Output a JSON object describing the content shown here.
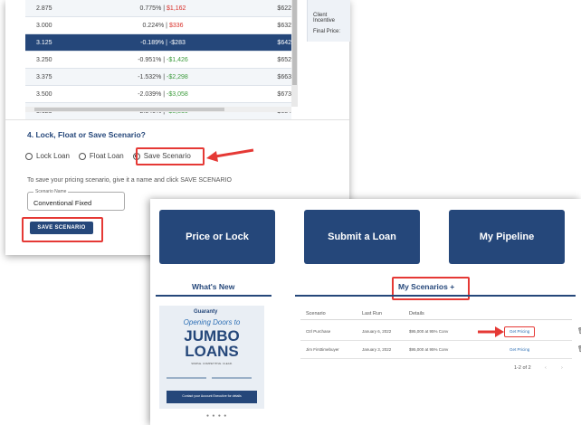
{
  "rates": {
    "rows": [
      {
        "rate": "2.875",
        "change": "0.775%",
        "amount": "$1,162",
        "amount_sign": "neg",
        "payment": "$622",
        "selected": false
      },
      {
        "rate": "3.000",
        "change": "0.224%",
        "amount": "$336",
        "amount_sign": "neg",
        "payment": "$632",
        "selected": false
      },
      {
        "rate": "3.125",
        "change": "-0.189%",
        "amount": "-$283",
        "amount_sign": "neg",
        "payment": "$642",
        "selected": true
      },
      {
        "rate": "3.250",
        "change": "-0.951%",
        "amount": "-$1,426",
        "amount_sign": "pos",
        "payment": "$652",
        "selected": false
      },
      {
        "rate": "3.375",
        "change": "-1.532%",
        "amount": "-$2,298",
        "amount_sign": "pos",
        "payment": "$663",
        "selected": false
      },
      {
        "rate": "3.500",
        "change": "-2.039%",
        "amount": "-$3,058",
        "amount_sign": "pos",
        "payment": "$673",
        "selected": false
      },
      {
        "rate": "3.625",
        "change": "-2.540%",
        "amount": "-$3,810",
        "amount_sign": "pos",
        "payment": "$684",
        "selected": false
      }
    ],
    "separator": "|",
    "side_client_incentive": "Client Incentive",
    "side_final_price": "Final Price:"
  },
  "lock_section": {
    "title": "4. Lock, Float or Save Scenario?",
    "options": [
      "Lock Loan",
      "Float Loan",
      "Save Scenario"
    ],
    "selected": "Save Scenario",
    "hint": "To save your pricing scenario, give it a name and click SAVE SCENARIO",
    "name_label": "Scenario Name",
    "name_value": "Conventional Fixed",
    "save_label": "SAVE SCENARIO"
  },
  "dashboard": {
    "tiles": [
      "Price or Lock",
      "Submit a Loan",
      "My Pipeline"
    ],
    "whats_new": "What's New",
    "my_scenarios": "My Scenarios",
    "add": "+",
    "promo": {
      "logo": "Guaranty",
      "subtitle": "Opening Doors to",
      "line1": "JUMBO",
      "line2": "LOANS",
      "tagline": "SIMPLE. COMPETITIVE. CLEAR.",
      "contact": "Contact your Account Executive for details"
    },
    "columns": [
      "Scenario",
      "Last Run",
      "Details"
    ],
    "rows": [
      {
        "scenario": "Ctrl Purchase",
        "last_run": "January 6, 2022",
        "details": "$95,000 at 95% Conv",
        "action": "Get Pricing"
      },
      {
        "scenario": "Jim Firsttimebuyer",
        "last_run": "January 3, 2022",
        "details": "$95,000 at 95% Conv",
        "action": "Get Pricing"
      }
    ],
    "pager": "1-2 of 2",
    "accent": "#25477a",
    "highlight": "#e53935"
  }
}
